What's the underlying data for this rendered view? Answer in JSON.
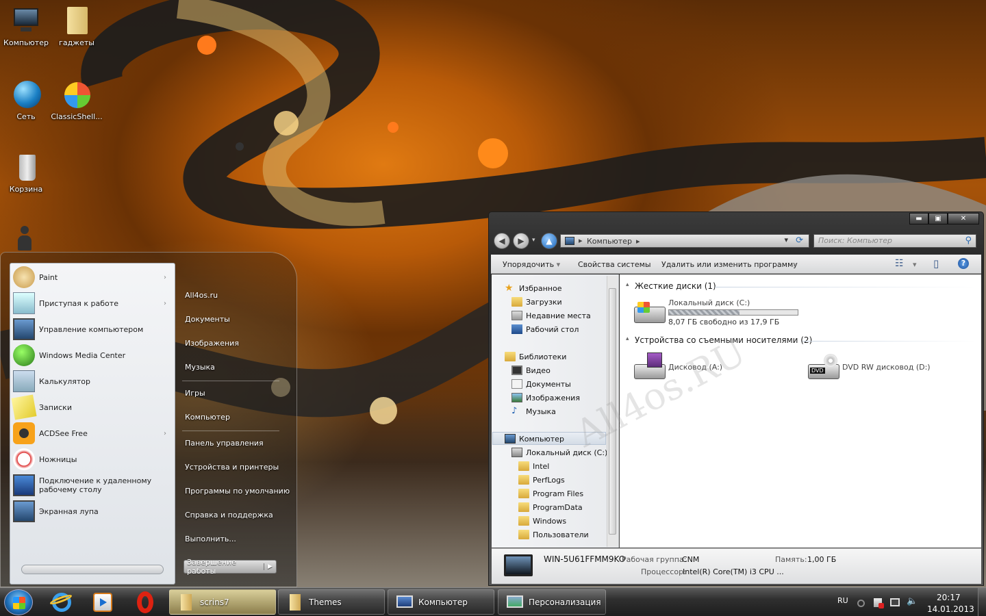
{
  "desktop": {
    "icons": [
      {
        "label": "Компьютер",
        "icon": "monitor-icon"
      },
      {
        "label": "гаджеты",
        "icon": "folder-icon"
      },
      {
        "label": "Сеть",
        "icon": "globe-icon"
      },
      {
        "label": "ClassicShell...",
        "icon": "classicshell-icon"
      },
      {
        "label": "Корзина",
        "icon": "recycle-bin-icon"
      }
    ]
  },
  "start_menu": {
    "programs": [
      {
        "label": "Paint",
        "submenu": true
      },
      {
        "label": "Приступая к работе",
        "submenu": true
      },
      {
        "label": "Управление компьютером",
        "submenu": false
      },
      {
        "label": "Windows Media Center",
        "submenu": false
      },
      {
        "label": "Калькулятор",
        "submenu": false
      },
      {
        "label": "Записки",
        "submenu": false
      },
      {
        "label": "ACDSee Free",
        "submenu": true
      },
      {
        "label": "Ножницы",
        "submenu": false
      },
      {
        "label": "Подключение к удаленному рабочему столу",
        "submenu": false
      },
      {
        "label": "Экранная лупа",
        "submenu": false
      }
    ],
    "places": [
      "All4os.ru",
      "Документы",
      "Изображения",
      "Музыка",
      "Игры",
      "Компьютер",
      "Панель управления",
      "Устройства и принтеры",
      "Программы по умолчанию",
      "Справка и поддержка",
      "Выполнить..."
    ],
    "shutdown_label": "Завершение работы",
    "arrow_glyph": "›",
    "shutdown_arrow": "▶"
  },
  "explorer": {
    "caption_buttons": {
      "minimize": "▬",
      "maximize": "▣",
      "close": "✕"
    },
    "nav_glyphs": {
      "back": "◀",
      "forward": "▶",
      "up": "▲",
      "dropdown": "▾",
      "refresh": "⟳",
      "search": "⚲"
    },
    "address": "Компьютер",
    "address_sep": "▸",
    "search_placeholder": "Поиск: Компьютер",
    "commands": [
      "Упорядочить",
      "Свойства системы",
      "Удалить или изменить программу",
      "»"
    ],
    "cmd_glyphs": {
      "organize_arrow": "▾",
      "views": "☷",
      "preview": "▯",
      "help": "?"
    },
    "nav_pane": {
      "favorites": {
        "label": "Избранное",
        "items": [
          "Загрузки",
          "Недавние места",
          "Рабочий стол"
        ]
      },
      "libraries": {
        "label": "Библиотеки",
        "items": [
          "Видео",
          "Документы",
          "Изображения",
          "Музыка"
        ]
      },
      "computer": {
        "label": "Компьютер",
        "drive": "Локальный диск (C:)",
        "folders": [
          "Intel",
          "PerfLogs",
          "Program Files",
          "ProgramData",
          "Windows",
          "Пользователи"
        ]
      }
    },
    "groups": {
      "hard_disks": "Жесткие диски (1)",
      "removable": "Устройства со съемными носителями (2)"
    },
    "drives": {
      "c": {
        "label": "Локальный диск (C:)",
        "space": "8,07 ГБ свободно из 17,9 ГБ",
        "used_fraction": 0.55
      },
      "a": {
        "label": "Дисковод (A:)"
      },
      "d": {
        "label": "DVD RW дисковод (D:)",
        "badge": "DVD"
      }
    },
    "details": {
      "name": "WIN-5U61FFMM9KO",
      "workgroup_label": "Рабочая группа:",
      "workgroup": "CNM",
      "memory_label": "Память:",
      "memory": "1,00 ГБ",
      "cpu_label": "Процессор:",
      "cpu": "Intel(R) Core(TM) i3 CPU ..."
    },
    "watermark": "All4os.RU"
  },
  "taskbar": {
    "buttons": [
      {
        "label": "scrins7",
        "icon": "folder-icon",
        "active": true
      },
      {
        "label": "Themes",
        "icon": "folder-icon",
        "active": false
      },
      {
        "label": "Компьютер",
        "icon": "computer-icon",
        "active": false
      },
      {
        "label": "Персонализация",
        "icon": "personalization-icon",
        "active": false
      }
    ],
    "lang": "RU",
    "time": "20:17",
    "date": "14.01.2013",
    "tray_glyphs": {
      "volume": "🔈"
    }
  },
  "colors": {
    "accent": "#d6850f",
    "taskbar_active": "#c8bb7f"
  }
}
